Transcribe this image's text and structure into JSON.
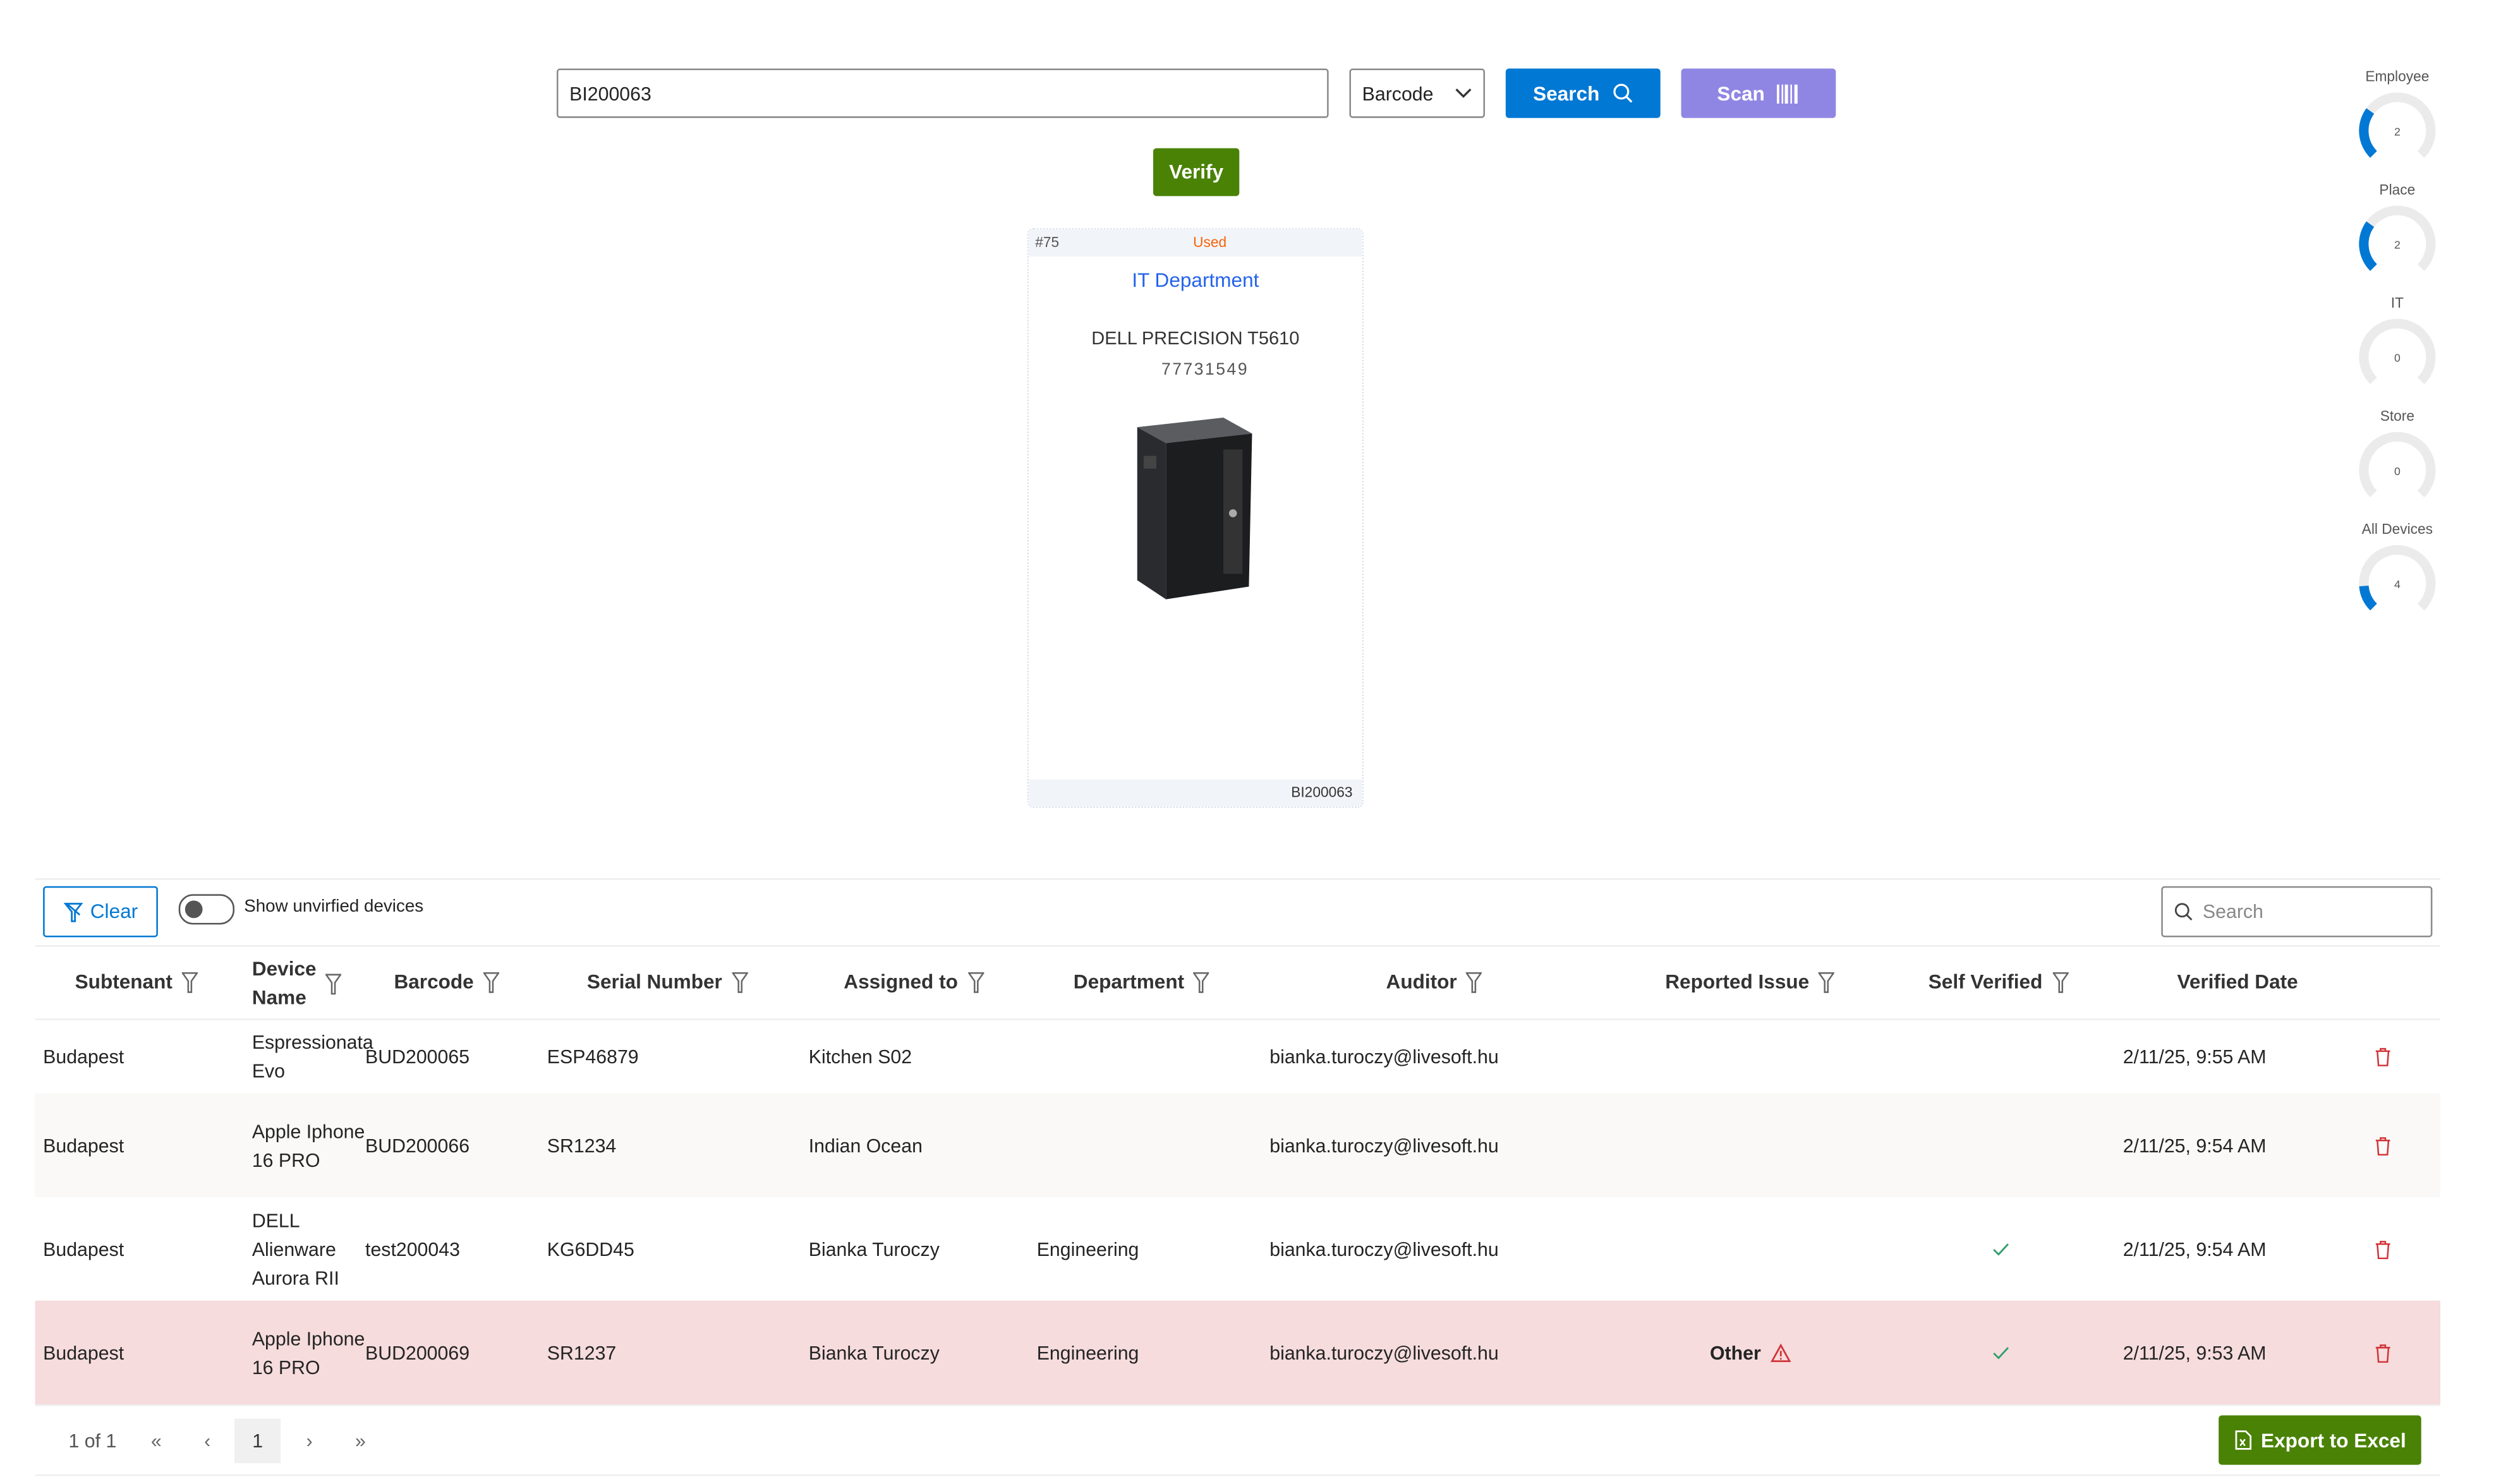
{
  "search": {
    "value": "BI200063",
    "type_select": "Barcode",
    "search_label": "Search",
    "scan_label": "Scan",
    "verify_label": "Verify"
  },
  "card": {
    "number": "#75",
    "status": "Used",
    "department": "IT Department",
    "device_name": "DELL PRECISION T5610",
    "serial": "77731549",
    "barcode": "BI200063"
  },
  "gauges": [
    {
      "label": "Employee",
      "value": "2",
      "fill": 0.3
    },
    {
      "label": "Place",
      "value": "2",
      "fill": 0.3
    },
    {
      "label": "IT",
      "value": "0",
      "fill": 0
    },
    {
      "label": "Store",
      "value": "0",
      "fill": 0
    },
    {
      "label": "All Devices",
      "value": "4",
      "fill": 0.15
    }
  ],
  "toolbar": {
    "clear_label": "Clear",
    "toggle_label": "Show unvirfied devices",
    "toggle_on": false,
    "search_placeholder": "Search"
  },
  "table": {
    "headers": {
      "subtenant": "Subtenant",
      "device_name_1": "Device",
      "device_name_2": "Name",
      "barcode": "Barcode",
      "serial": "Serial Number",
      "assigned": "Assigned to",
      "department": "Department",
      "auditor": "Auditor",
      "issue": "Reported Issue",
      "self_verified": "Self Verified",
      "verified_date": "Verified Date"
    },
    "rows": [
      {
        "subtenant": "Budapest",
        "device": "Espressionata Evo",
        "barcode": "BUD200065",
        "serial": "ESP46879",
        "assigned": "Kitchen S02",
        "department": "",
        "auditor": "bianka.turoczy@livesoft.hu",
        "issue": "",
        "self_verified": false,
        "date": "2/11/25, 9:55 AM"
      },
      {
        "subtenant": "Budapest",
        "device": "Apple Iphone 16 PRO",
        "barcode": "BUD200066",
        "serial": "SR1234",
        "assigned": "Indian Ocean",
        "department": "",
        "auditor": "bianka.turoczy@livesoft.hu",
        "issue": "",
        "self_verified": false,
        "date": "2/11/25, 9:54 AM"
      },
      {
        "subtenant": "Budapest",
        "device": "DELL Alienware Aurora RII",
        "barcode": "test200043",
        "serial": "KG6DD45",
        "assigned": "Bianka Turoczy",
        "department": "Engineering",
        "auditor": "bianka.turoczy@livesoft.hu",
        "issue": "",
        "self_verified": true,
        "date": "2/11/25, 9:54 AM"
      },
      {
        "subtenant": "Budapest",
        "device": "Apple Iphone 16 PRO",
        "barcode": "BUD200069",
        "serial": "SR1237",
        "assigned": "Bianka Turoczy",
        "department": "Engineering",
        "auditor": "bianka.turoczy@livesoft.hu",
        "issue": "Other",
        "self_verified": true,
        "date": "2/11/25, 9:53 AM"
      }
    ]
  },
  "pager": {
    "summary": "1 of 1",
    "current_page": "1",
    "export_label": "Export to Excel"
  },
  "colors": {
    "primary": "#0078d4",
    "scan": "#8f86e4",
    "green": "#498205",
    "used": "#f7630c",
    "dept": "#2563eb",
    "issue_row": "#f6dcdd",
    "delete": "#d13438"
  }
}
